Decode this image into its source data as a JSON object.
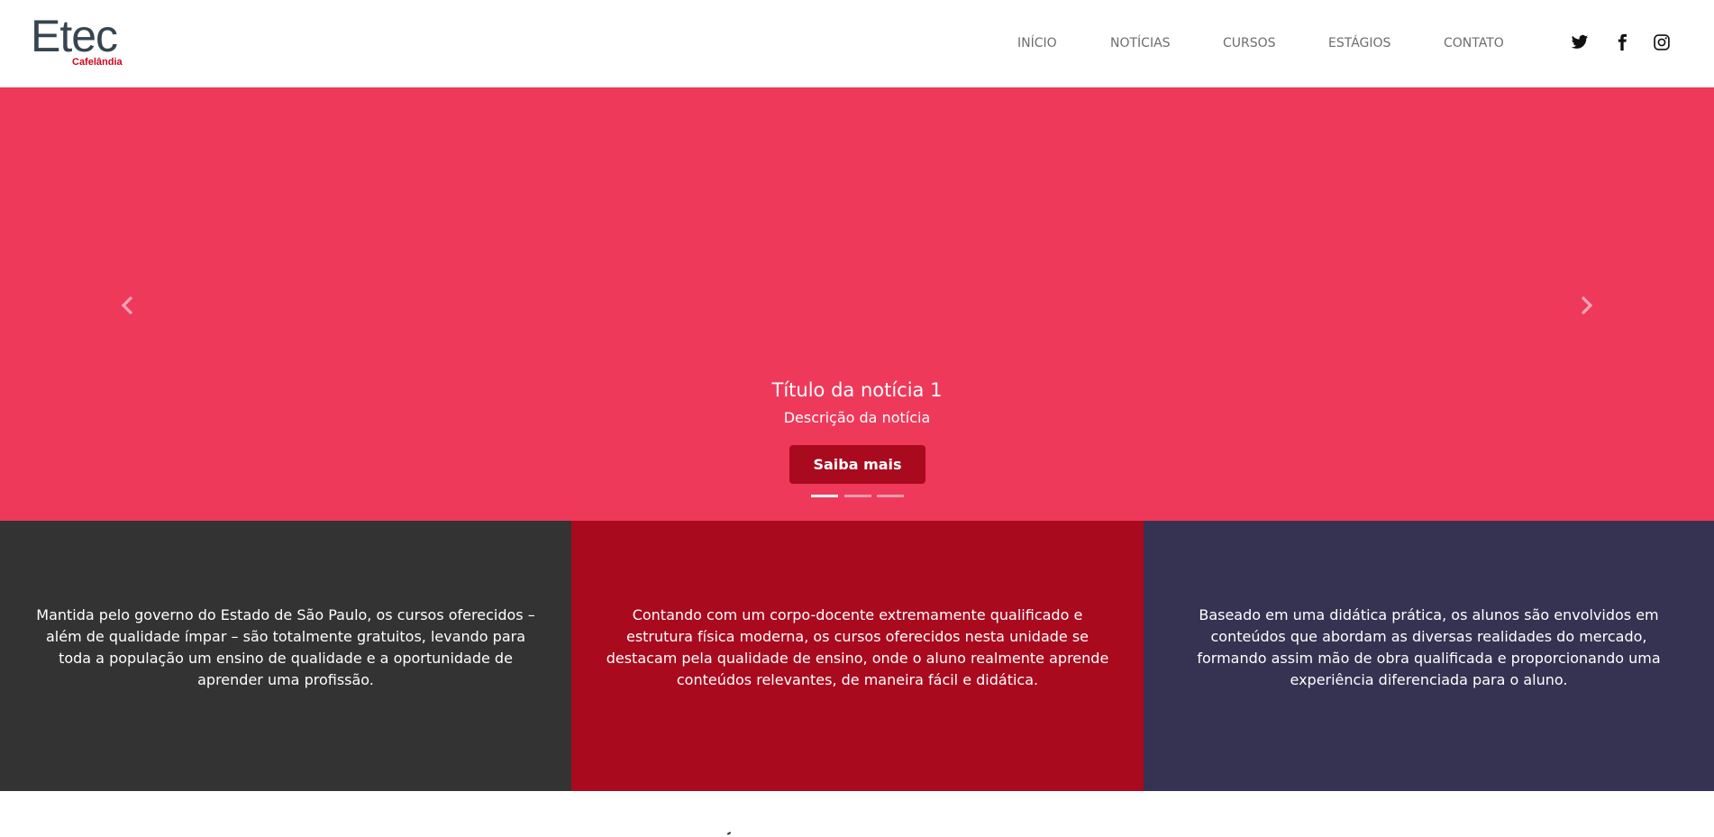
{
  "brand": {
    "name": "Etec",
    "subtitle": "Cafelândia"
  },
  "nav": {
    "items": [
      {
        "label": "INÍCIO"
      },
      {
        "label": "NOTÍCIAS"
      },
      {
        "label": "CURSOS"
      },
      {
        "label": "ESTÁGIOS"
      },
      {
        "label": "CONTATO"
      }
    ]
  },
  "social": {
    "icons": [
      "twitter-icon",
      "facebook-icon",
      "instagram-icon"
    ]
  },
  "carousel": {
    "background_color": "#ef395b",
    "slide": {
      "title": "Título da notícia 1",
      "description": "Descrição da notícia",
      "button_label": "Saiba mais"
    },
    "indicator_count": 3,
    "active_indicator": 1,
    "prev_icon": "chevron-left-icon",
    "next_icon": "chevron-right-icon"
  },
  "features": [
    {
      "text": "Mantida pelo governo do Estado de São Paulo, os cursos oferecidos – além de qualidade ímpar – são totalmente gratuitos, levando para toda a população um ensino de qualidade e a oportunidade de aprender uma profissão.",
      "color": "#333333"
    },
    {
      "text": "Contando com um corpo-docente extremamente qualificado e estrutura física moderna, os cursos oferecidos nesta unidade se destacam pela qualidade de ensino, onde o aluno realmente aprende conteúdos relevantes, de maneira fácil e didática.",
      "color": "#a90a1e"
    },
    {
      "text": "Baseado em uma didática prática, os alunos são envolvidos em conteúdos que abordam as diversas realidades do mercado, formando assim mão de obra qualificada e proporcionando uma experiência diferenciada para o aluno.",
      "color": "#363251"
    }
  ],
  "colors": {
    "accent": "#d0021b",
    "button": "#a90a1e",
    "logo": "#36454f",
    "nav_text": "#6d6d6d"
  }
}
